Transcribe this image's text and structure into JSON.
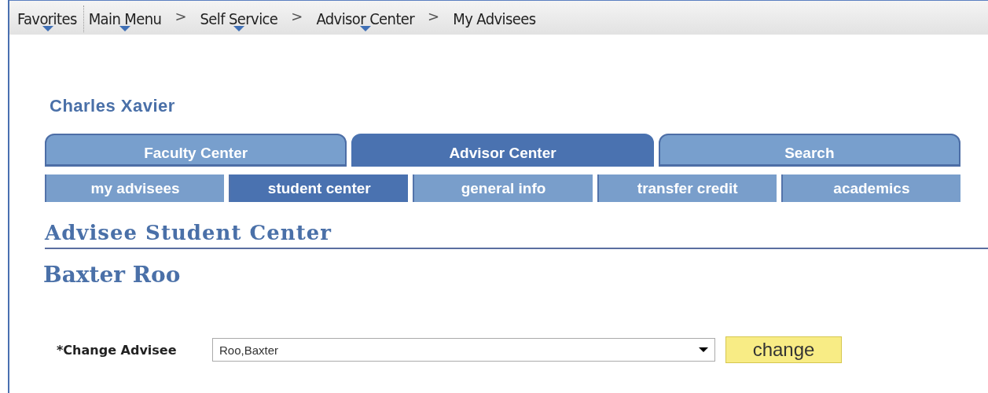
{
  "nav": {
    "favorites": {
      "label": "Favorites",
      "has_menu": true
    },
    "crumbs": [
      {
        "label": "Main Menu",
        "has_menu": true
      },
      {
        "separator": ">",
        "label": "Self Service",
        "has_menu": true
      },
      {
        "separator": ">",
        "label": "Advisor Center",
        "has_menu": true
      },
      {
        "separator": ">",
        "label": "My Advisees",
        "has_menu": false
      }
    ]
  },
  "user_name": "Charles Xavier",
  "tabs": [
    {
      "label": "Faculty Center",
      "selected": false
    },
    {
      "label": "Advisor Center",
      "selected": true
    },
    {
      "label": "Search",
      "selected": false
    }
  ],
  "subtabs": [
    {
      "label": "my advisees",
      "selected": false
    },
    {
      "label": "student center",
      "selected": true
    },
    {
      "label": "general info",
      "selected": false
    },
    {
      "label": "transfer credit",
      "selected": false
    },
    {
      "label": "academics",
      "selected": false
    }
  ],
  "page_title": "Advisee Student Center",
  "student_name": "Baxter Roo",
  "advisee": {
    "label": "*Change Advisee",
    "value": "Roo,Baxter",
    "button": "change"
  }
}
